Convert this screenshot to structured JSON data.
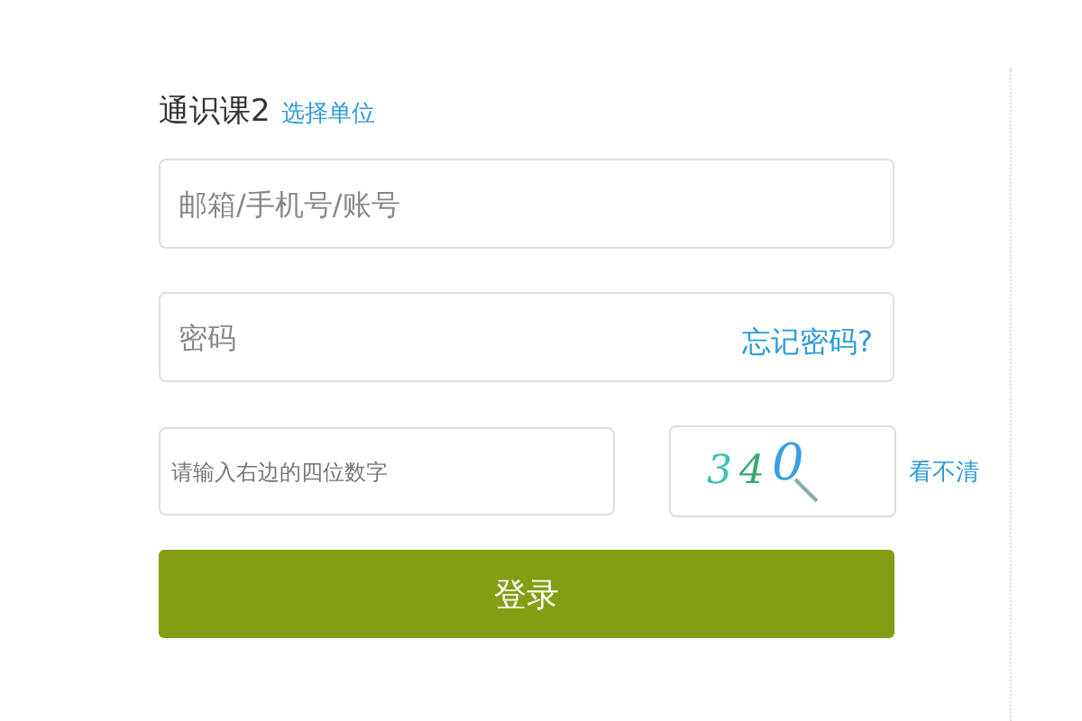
{
  "header": {
    "title": "通识课2",
    "link": "选择单位"
  },
  "fields": [
    {
      "placeholder": "邮箱/手机号/账号"
    },
    {
      "placeholder": "密码",
      "link": "忘记密码?"
    }
  ],
  "captcha": {
    "placeholder": "请输入右边的四位数字",
    "code": "340",
    "refresh": "看不清"
  },
  "submit": "登录"
}
